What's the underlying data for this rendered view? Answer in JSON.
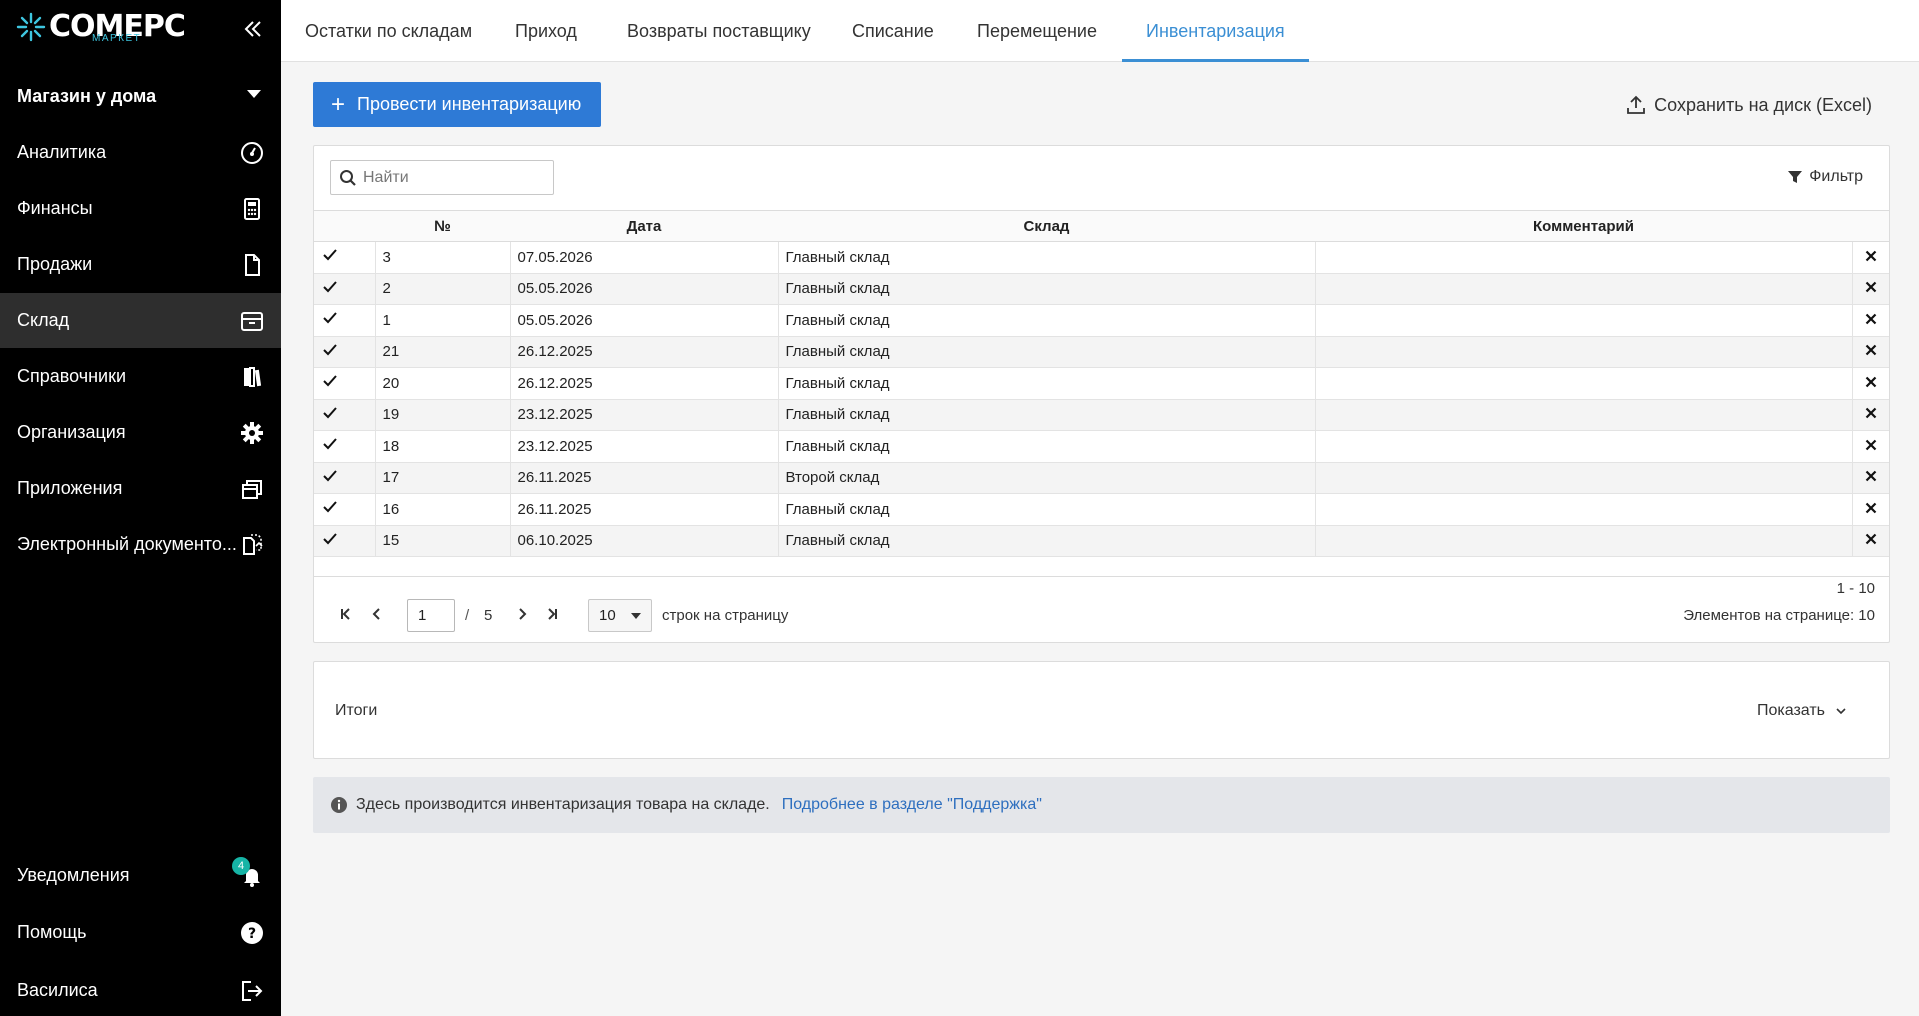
{
  "brand": {
    "name": "COMEPC",
    "sub": "МАРКЕТ",
    "accent_color": "#3ec6e0"
  },
  "sidebar": {
    "store": "Магазин у дома",
    "items": [
      {
        "label": "Аналитика",
        "icon": "speedometer-icon"
      },
      {
        "label": "Финансы",
        "icon": "calculator-icon"
      },
      {
        "label": "Продажи",
        "icon": "document-icon"
      },
      {
        "label": "Склад",
        "icon": "warehouse-box-icon",
        "active": true
      },
      {
        "label": "Справочники",
        "icon": "books-icon"
      },
      {
        "label": "Организация",
        "icon": "gear-icon"
      },
      {
        "label": "Приложения",
        "icon": "windows-icon"
      },
      {
        "label": "Электронный документо...",
        "icon": "edoc-icon"
      }
    ],
    "bottom": [
      {
        "label": "Уведомления",
        "icon": "bell-icon",
        "badge": "4"
      },
      {
        "label": "Помощь",
        "icon": "help-icon"
      },
      {
        "label": "Василиса",
        "icon": "logout-icon"
      }
    ]
  },
  "tabs": [
    {
      "label": "Остатки по складам"
    },
    {
      "label": "Приход"
    },
    {
      "label": "Возвраты поставщику"
    },
    {
      "label": "Списание"
    },
    {
      "label": "Перемещение"
    },
    {
      "label": "Инвентаризация",
      "active": true
    }
  ],
  "toolbar": {
    "primary_label": "Провести инвентаризацию",
    "export_label": "Сохранить на диск (Excel)",
    "primary_color": "#2e7ad6"
  },
  "grid": {
    "search_placeholder": "Найти",
    "filter_label": "Фильтр",
    "columns": [
      "№",
      "Дата",
      "Склад",
      "Комментарий"
    ],
    "rows": [
      {
        "num": "3",
        "date": "07.05.2026",
        "store": "Главный склад",
        "comment": ""
      },
      {
        "num": "2",
        "date": "05.05.2026",
        "store": "Главный склад",
        "comment": ""
      },
      {
        "num": "1",
        "date": "05.05.2026",
        "store": "Главный склад",
        "comment": ""
      },
      {
        "num": "21",
        "date": "26.12.2025",
        "store": "Главный склад",
        "comment": ""
      },
      {
        "num": "20",
        "date": "26.12.2025",
        "store": "Главный склад",
        "comment": ""
      },
      {
        "num": "19",
        "date": "23.12.2025",
        "store": "Главный склад",
        "comment": ""
      },
      {
        "num": "18",
        "date": "23.12.2025",
        "store": "Главный склад",
        "comment": ""
      },
      {
        "num": "17",
        "date": "26.11.2025",
        "store": "Второй склад",
        "comment": ""
      },
      {
        "num": "16",
        "date": "26.11.2025",
        "store": "Главный склад",
        "comment": ""
      },
      {
        "num": "15",
        "date": "06.10.2025",
        "store": "Главный склад",
        "comment": ""
      }
    ]
  },
  "pager": {
    "page": "1",
    "separator": "/",
    "total_pages": "5",
    "page_size": "10",
    "rows_label": "строк на страницу",
    "range": "1 - 10",
    "per_page_text": "Элементов на странице: 10"
  },
  "totals": {
    "title": "Итоги",
    "toggle": "Показать"
  },
  "info": {
    "text": "Здесь производится инвентаризация товара на складе.",
    "link": "Подробнее в разделе \"Поддержка\""
  }
}
